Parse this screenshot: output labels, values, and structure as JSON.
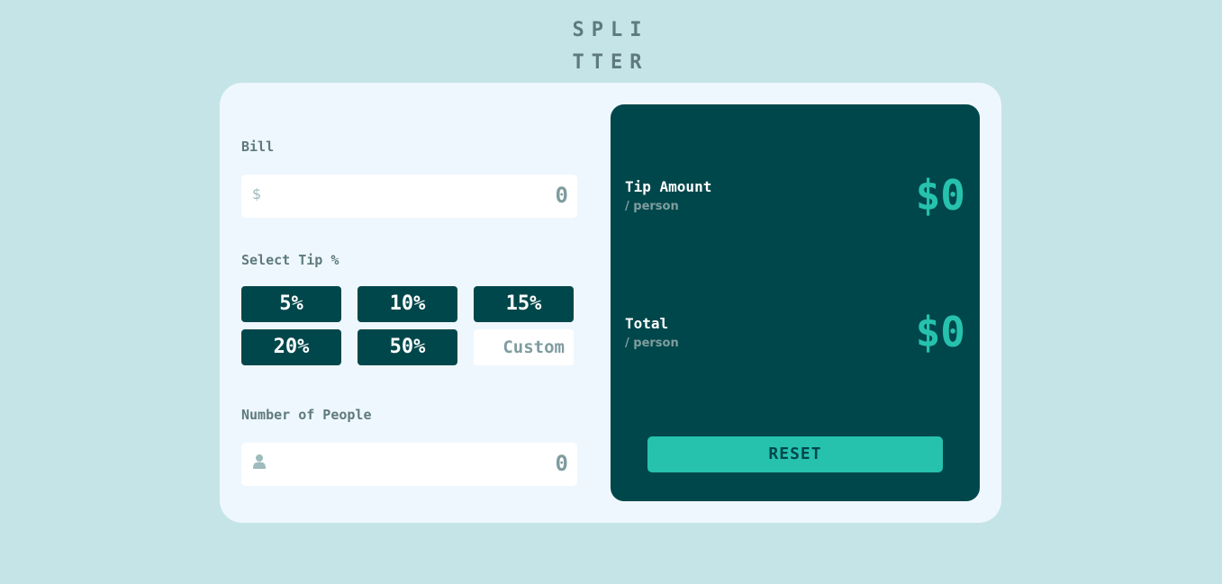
{
  "logo": {
    "line1": "SPLI",
    "line2": "TTER"
  },
  "bill": {
    "label": "Bill",
    "icon": "$",
    "value": "0"
  },
  "tip": {
    "label": "Select Tip %",
    "options": [
      "5%",
      "10%",
      "15%",
      "20%",
      "50%"
    ],
    "custom_placeholder": "Custom"
  },
  "people": {
    "label": "Number of People",
    "icon": "person-icon",
    "value": "0"
  },
  "results": {
    "tip_amount": {
      "title": "Tip Amount",
      "sub": "/ person",
      "value": "$0"
    },
    "total": {
      "title": "Total",
      "sub": "/ person",
      "value": "$0"
    },
    "reset_label": "RESET"
  },
  "colors": {
    "background": "#c5e4e7",
    "card": "#eff7fe",
    "dark_cyan": "#00474b",
    "strong_cyan": "#26c2ae",
    "label_gray": "#5e7a7d"
  }
}
